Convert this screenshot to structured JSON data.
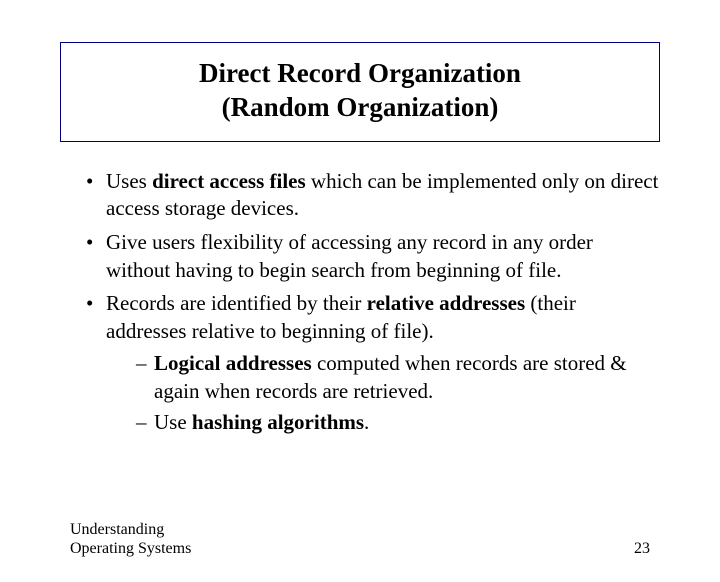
{
  "title": {
    "line1": "Direct Record Organization",
    "line2": "(Random Organization)"
  },
  "bullets": {
    "b1_pre": "Uses ",
    "b1_bold": "direct access files",
    "b1_post": " which can be implemented only on direct access storage devices.",
    "b2": "Give users flexibility of accessing any record in any order without having to begin search from beginning of file.",
    "b3_pre": "Records are identified by their ",
    "b3_bold": "relative addresses",
    "b3_post": " (their addresses relative to beginning of file).",
    "s1_bold": "Logical addresses",
    "s1_post": " computed when records are stored & again when records are retrieved.",
    "s2_pre": "Use ",
    "s2_bold": "hashing algorithms",
    "s2_post": "."
  },
  "footer": {
    "left": "Understanding Operating Systems",
    "page": "23"
  }
}
